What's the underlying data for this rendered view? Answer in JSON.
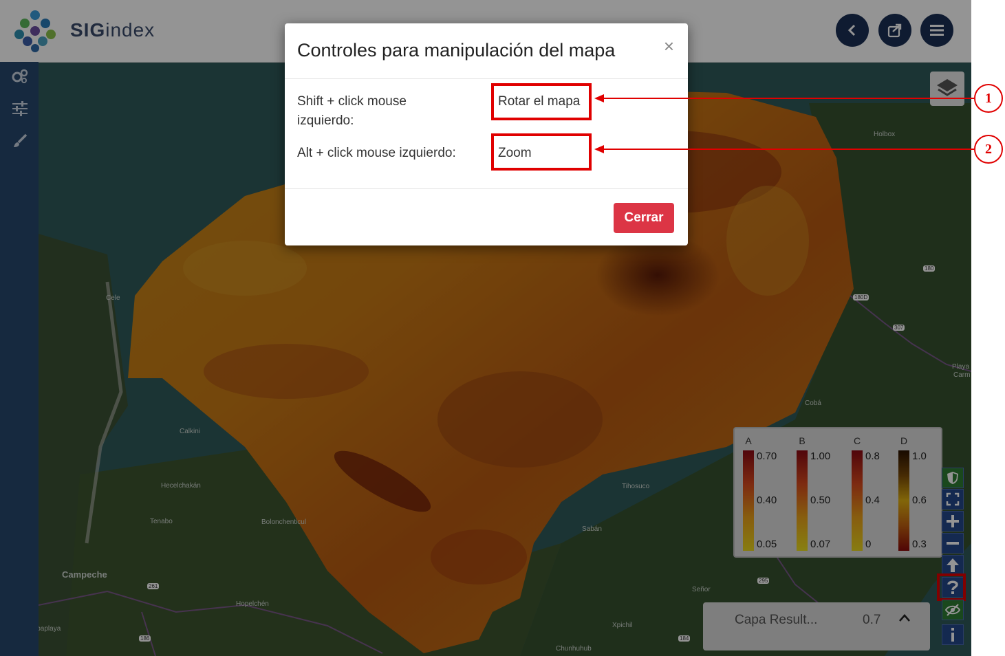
{
  "app": {
    "logo_text_bold": "SIG",
    "logo_text_thin": "index"
  },
  "header_buttons": [
    {
      "icon": "chevron-left-icon"
    },
    {
      "icon": "share-icon"
    },
    {
      "icon": "hamburger-menu-icon"
    }
  ],
  "sidebar": {
    "items": [
      {
        "icon": "gears-icon"
      },
      {
        "icon": "sliders-icon"
      },
      {
        "icon": "paintbrush-icon"
      }
    ]
  },
  "map_labels": {
    "holbox": "Holbox",
    "celestun": "Cele",
    "calkini": "Calkini",
    "hecelchakan": "Hecelchakán",
    "tenabo": "Tenabo",
    "bolonchenticul": "Bolonchenticul",
    "campeche": "Campeche",
    "hopelchen": "Hopelchén",
    "seybaplaya": "Seybaplaya",
    "tihosuco": "Tihosuco",
    "saban": "Sabán",
    "senor": "Señor",
    "xpichil": "Xpichil",
    "chunhuhub": "Chunhuhub",
    "coba": "Cobá",
    "playa": "Playa",
    "playa2": "Carm",
    "shield_180": "180",
    "shield_180d": "180D",
    "shield_307": "307",
    "shield_295": "295",
    "shield_184": "184",
    "shield_261": "261",
    "shield_186": "186"
  },
  "legend": {
    "columns": [
      {
        "letter": "A",
        "top": "0.70",
        "mid": "0.40",
        "bottom": "0.05"
      },
      {
        "letter": "B",
        "top": "1.00",
        "mid": "0.50",
        "bottom": "0.07"
      },
      {
        "letter": "C",
        "top": "0.8",
        "mid": "0.4",
        "bottom": "0"
      },
      {
        "letter": "D",
        "top": "1.0",
        "mid": "0.6",
        "bottom": "0.3"
      }
    ]
  },
  "map_controls": [
    "shield-icon",
    "fullscreen-icon",
    "zoom-in-icon",
    "zoom-out-icon",
    "north-arrow-icon",
    "help-icon",
    "eye-slash-icon",
    "info-icon"
  ],
  "layer_panel": {
    "name": "Capa Result...",
    "opacity": "0.7"
  },
  "modal": {
    "title": "Controles para manipulación del mapa",
    "close": "×",
    "rows": [
      {
        "key_line1": "Shift + click mouse",
        "key_line2": "izquierdo:",
        "value": "Rotar el mapa"
      },
      {
        "key_line1": "Alt + click mouse izquierdo:",
        "key_line2": "",
        "value": "Zoom"
      }
    ],
    "button": "Cerrar"
  },
  "callouts": [
    "1",
    "2"
  ],
  "colors": {
    "header_btn": "#1b2f55",
    "sidebar": "#26476d",
    "highlight": "#e00000",
    "cerrar": "#dc3545"
  }
}
